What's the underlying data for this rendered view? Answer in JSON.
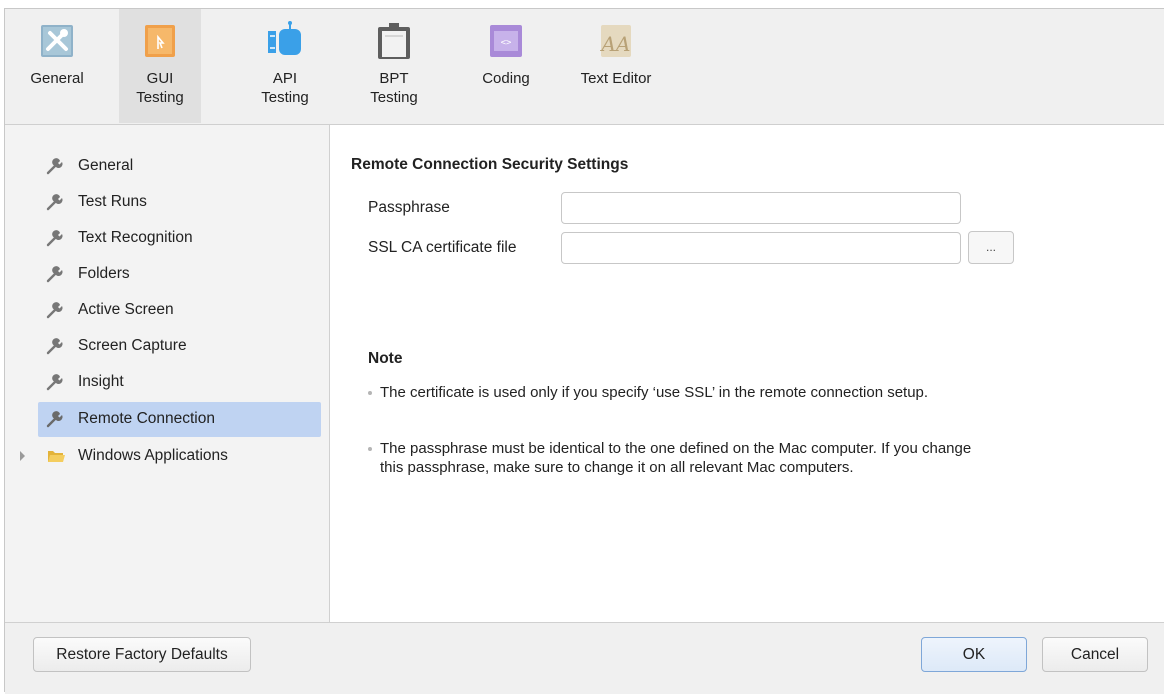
{
  "toolbar": {
    "tabs": [
      {
        "label": "General",
        "icon": "tools-icon",
        "active": false
      },
      {
        "label": "GUI\nTesting",
        "icon": "gui-testing-icon",
        "active": true
      },
      {
        "label": "API\nTesting",
        "icon": "api-testing-icon",
        "active": false
      },
      {
        "label": "BPT\nTesting",
        "icon": "bpt-testing-icon",
        "active": false
      },
      {
        "label": "Coding",
        "icon": "coding-icon",
        "active": false
      },
      {
        "label": "Text Editor",
        "icon": "text-editor-icon",
        "active": false
      }
    ]
  },
  "sidebar": {
    "items": [
      {
        "label": "General",
        "icon": "wrench-icon"
      },
      {
        "label": "Test Runs",
        "icon": "wrench-icon"
      },
      {
        "label": "Text Recognition",
        "icon": "wrench-icon"
      },
      {
        "label": "Folders",
        "icon": "wrench-icon"
      },
      {
        "label": "Active Screen",
        "icon": "wrench-icon"
      },
      {
        "label": "Screen Capture",
        "icon": "wrench-icon"
      },
      {
        "label": "Insight",
        "icon": "wrench-icon"
      },
      {
        "label": "Remote Connection",
        "icon": "wrench-icon",
        "selected": true
      },
      {
        "label": "Windows Applications",
        "icon": "folder-icon",
        "expandable": true
      }
    ]
  },
  "main": {
    "section_title": "Remote Connection Security Settings",
    "passphrase": {
      "label": "Passphrase",
      "value": ""
    },
    "ssl_ca_file": {
      "label": "SSL CA certificate file",
      "value": "",
      "browse_label": "..."
    },
    "note": {
      "title": "Note",
      "bullets": [
        "The certificate is used only if you specify ‘use SSL’ in the remote connection setup.",
        "The passphrase must be identical to the one defined on the Mac computer. If you change this passphrase, make sure to change it on all relevant Mac computers."
      ]
    }
  },
  "footer": {
    "restore_label": "Restore Factory Defaults",
    "ok_label": "OK",
    "cancel_label": "Cancel"
  },
  "colors": {
    "selection": "#bfd3f2",
    "toolbar_bg": "#f0f0f0",
    "sidebar_bg": "#f3f3f3",
    "ok_border": "#7fa7d8"
  }
}
